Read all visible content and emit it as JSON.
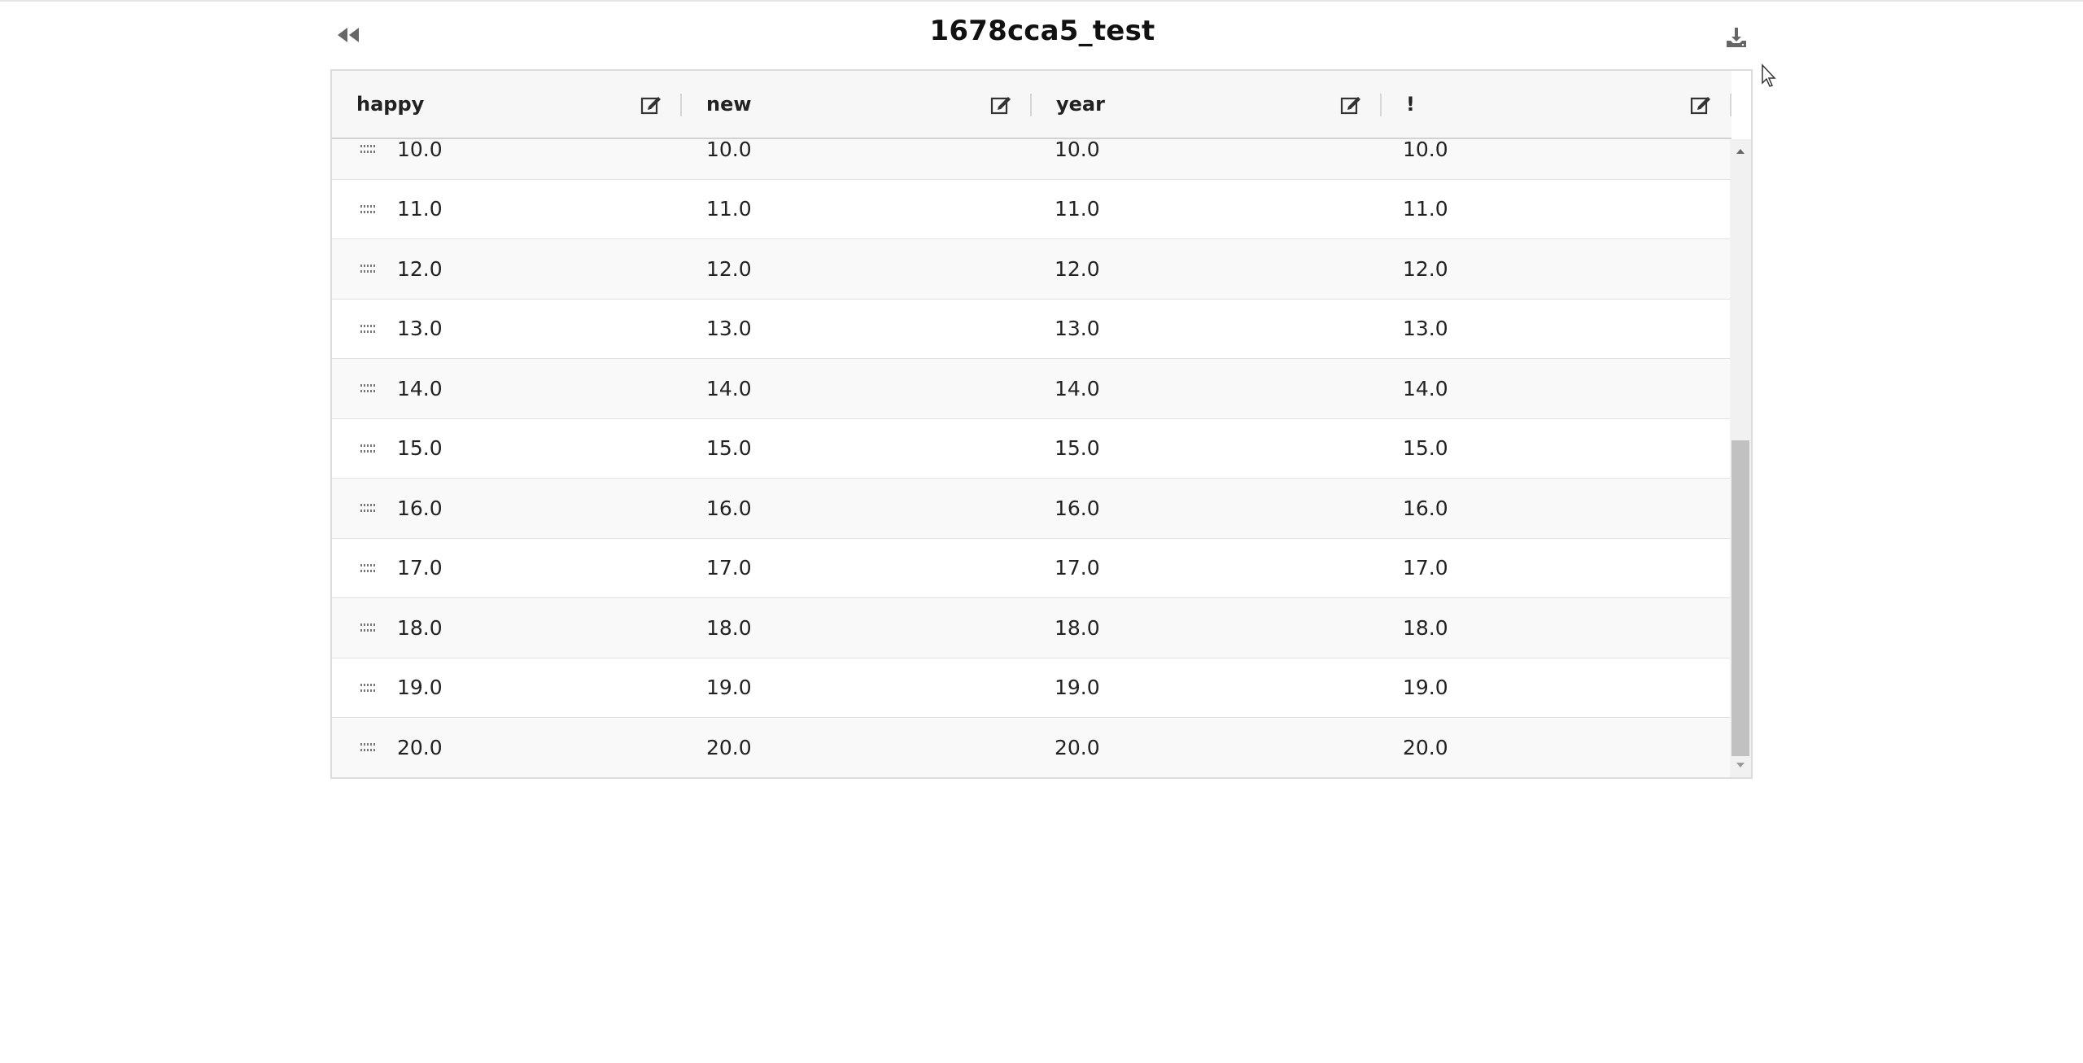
{
  "page": {
    "title": "1678cca5_test"
  },
  "toolbar": {
    "back_icon": "rewind-icon",
    "download_icon": "download-icon"
  },
  "table": {
    "columns": [
      {
        "label": "happy",
        "edit_icon": "edit-icon"
      },
      {
        "label": "new",
        "edit_icon": "edit-icon"
      },
      {
        "label": "year",
        "edit_icon": "edit-icon"
      },
      {
        "label": "!",
        "edit_icon": "edit-icon"
      }
    ],
    "rows": [
      [
        "10.0",
        "10.0",
        "10.0",
        "10.0"
      ],
      [
        "11.0",
        "11.0",
        "11.0",
        "11.0"
      ],
      [
        "12.0",
        "12.0",
        "12.0",
        "12.0"
      ],
      [
        "13.0",
        "13.0",
        "13.0",
        "13.0"
      ],
      [
        "14.0",
        "14.0",
        "14.0",
        "14.0"
      ],
      [
        "15.0",
        "15.0",
        "15.0",
        "15.0"
      ],
      [
        "16.0",
        "16.0",
        "16.0",
        "16.0"
      ],
      [
        "17.0",
        "17.0",
        "17.0",
        "17.0"
      ],
      [
        "18.0",
        "18.0",
        "18.0",
        "18.0"
      ],
      [
        "19.0",
        "19.0",
        "19.0",
        "19.0"
      ],
      [
        "20.0",
        "20.0",
        "20.0",
        "20.0"
      ]
    ],
    "row_handle_icon": "drag-handle-icon"
  },
  "colors": {
    "header_bg": "#f7f7f7",
    "row_alt_bg": "#f9f9f9",
    "border": "#dcdcdc",
    "scroll_thumb": "#c1c1c1",
    "icon": "#555555"
  }
}
